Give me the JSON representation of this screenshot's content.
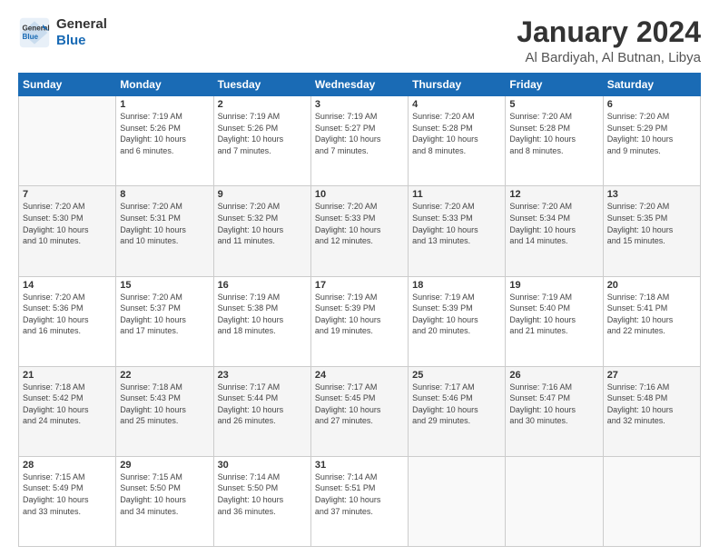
{
  "logo": {
    "line1": "General",
    "line2": "Blue"
  },
  "calendar": {
    "title": "January 2024",
    "subtitle": "Al Bardiyah, Al Butnan, Libya"
  },
  "weekdays": [
    "Sunday",
    "Monday",
    "Tuesday",
    "Wednesday",
    "Thursday",
    "Friday",
    "Saturday"
  ],
  "weeks": [
    [
      {
        "num": "",
        "info": ""
      },
      {
        "num": "1",
        "info": "Sunrise: 7:19 AM\nSunset: 5:26 PM\nDaylight: 10 hours\nand 6 minutes."
      },
      {
        "num": "2",
        "info": "Sunrise: 7:19 AM\nSunset: 5:26 PM\nDaylight: 10 hours\nand 7 minutes."
      },
      {
        "num": "3",
        "info": "Sunrise: 7:19 AM\nSunset: 5:27 PM\nDaylight: 10 hours\nand 7 minutes."
      },
      {
        "num": "4",
        "info": "Sunrise: 7:20 AM\nSunset: 5:28 PM\nDaylight: 10 hours\nand 8 minutes."
      },
      {
        "num": "5",
        "info": "Sunrise: 7:20 AM\nSunset: 5:28 PM\nDaylight: 10 hours\nand 8 minutes."
      },
      {
        "num": "6",
        "info": "Sunrise: 7:20 AM\nSunset: 5:29 PM\nDaylight: 10 hours\nand 9 minutes."
      }
    ],
    [
      {
        "num": "7",
        "info": "Sunrise: 7:20 AM\nSunset: 5:30 PM\nDaylight: 10 hours\nand 10 minutes."
      },
      {
        "num": "8",
        "info": "Sunrise: 7:20 AM\nSunset: 5:31 PM\nDaylight: 10 hours\nand 10 minutes."
      },
      {
        "num": "9",
        "info": "Sunrise: 7:20 AM\nSunset: 5:32 PM\nDaylight: 10 hours\nand 11 minutes."
      },
      {
        "num": "10",
        "info": "Sunrise: 7:20 AM\nSunset: 5:33 PM\nDaylight: 10 hours\nand 12 minutes."
      },
      {
        "num": "11",
        "info": "Sunrise: 7:20 AM\nSunset: 5:33 PM\nDaylight: 10 hours\nand 13 minutes."
      },
      {
        "num": "12",
        "info": "Sunrise: 7:20 AM\nSunset: 5:34 PM\nDaylight: 10 hours\nand 14 minutes."
      },
      {
        "num": "13",
        "info": "Sunrise: 7:20 AM\nSunset: 5:35 PM\nDaylight: 10 hours\nand 15 minutes."
      }
    ],
    [
      {
        "num": "14",
        "info": "Sunrise: 7:20 AM\nSunset: 5:36 PM\nDaylight: 10 hours\nand 16 minutes."
      },
      {
        "num": "15",
        "info": "Sunrise: 7:20 AM\nSunset: 5:37 PM\nDaylight: 10 hours\nand 17 minutes."
      },
      {
        "num": "16",
        "info": "Sunrise: 7:19 AM\nSunset: 5:38 PM\nDaylight: 10 hours\nand 18 minutes."
      },
      {
        "num": "17",
        "info": "Sunrise: 7:19 AM\nSunset: 5:39 PM\nDaylight: 10 hours\nand 19 minutes."
      },
      {
        "num": "18",
        "info": "Sunrise: 7:19 AM\nSunset: 5:39 PM\nDaylight: 10 hours\nand 20 minutes."
      },
      {
        "num": "19",
        "info": "Sunrise: 7:19 AM\nSunset: 5:40 PM\nDaylight: 10 hours\nand 21 minutes."
      },
      {
        "num": "20",
        "info": "Sunrise: 7:18 AM\nSunset: 5:41 PM\nDaylight: 10 hours\nand 22 minutes."
      }
    ],
    [
      {
        "num": "21",
        "info": "Sunrise: 7:18 AM\nSunset: 5:42 PM\nDaylight: 10 hours\nand 24 minutes."
      },
      {
        "num": "22",
        "info": "Sunrise: 7:18 AM\nSunset: 5:43 PM\nDaylight: 10 hours\nand 25 minutes."
      },
      {
        "num": "23",
        "info": "Sunrise: 7:17 AM\nSunset: 5:44 PM\nDaylight: 10 hours\nand 26 minutes."
      },
      {
        "num": "24",
        "info": "Sunrise: 7:17 AM\nSunset: 5:45 PM\nDaylight: 10 hours\nand 27 minutes."
      },
      {
        "num": "25",
        "info": "Sunrise: 7:17 AM\nSunset: 5:46 PM\nDaylight: 10 hours\nand 29 minutes."
      },
      {
        "num": "26",
        "info": "Sunrise: 7:16 AM\nSunset: 5:47 PM\nDaylight: 10 hours\nand 30 minutes."
      },
      {
        "num": "27",
        "info": "Sunrise: 7:16 AM\nSunset: 5:48 PM\nDaylight: 10 hours\nand 32 minutes."
      }
    ],
    [
      {
        "num": "28",
        "info": "Sunrise: 7:15 AM\nSunset: 5:49 PM\nDaylight: 10 hours\nand 33 minutes."
      },
      {
        "num": "29",
        "info": "Sunrise: 7:15 AM\nSunset: 5:50 PM\nDaylight: 10 hours\nand 34 minutes."
      },
      {
        "num": "30",
        "info": "Sunrise: 7:14 AM\nSunset: 5:50 PM\nDaylight: 10 hours\nand 36 minutes."
      },
      {
        "num": "31",
        "info": "Sunrise: 7:14 AM\nSunset: 5:51 PM\nDaylight: 10 hours\nand 37 minutes."
      },
      {
        "num": "",
        "info": ""
      },
      {
        "num": "",
        "info": ""
      },
      {
        "num": "",
        "info": ""
      }
    ]
  ]
}
